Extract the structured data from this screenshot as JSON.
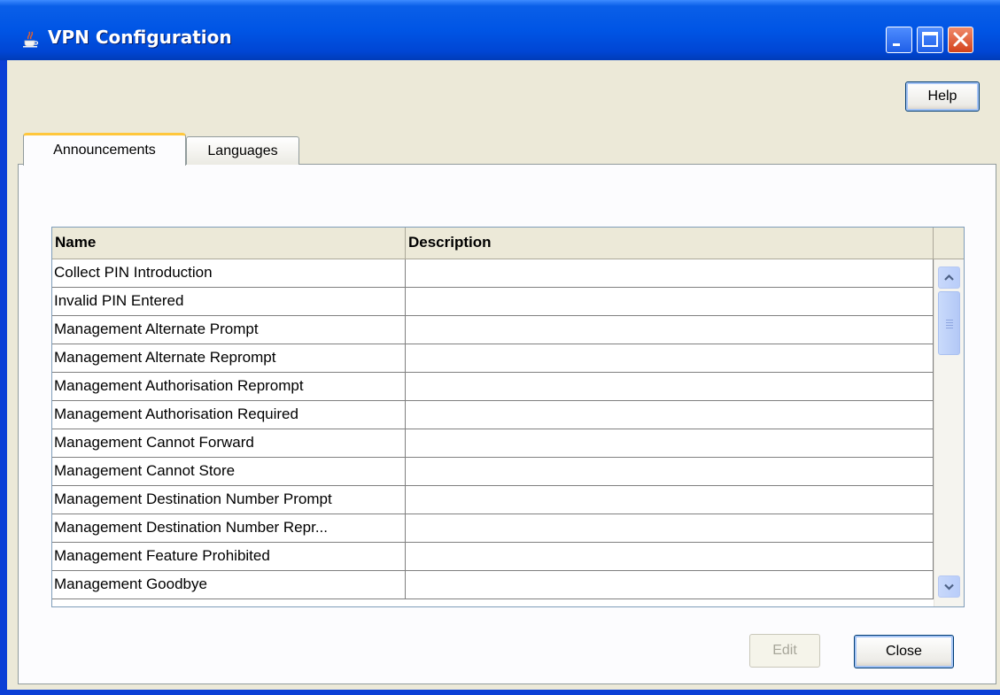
{
  "window": {
    "title": "VPN Configuration"
  },
  "toolbar": {
    "help_label": "Help"
  },
  "tabs": [
    {
      "label": "Announcements",
      "active": true
    },
    {
      "label": "Languages",
      "active": false
    }
  ],
  "table": {
    "columns": [
      "Name",
      "Description"
    ],
    "rows": [
      {
        "name": "Collect PIN Introduction",
        "description": ""
      },
      {
        "name": "Invalid PIN Entered",
        "description": ""
      },
      {
        "name": "Management Alternate Prompt",
        "description": ""
      },
      {
        "name": "Management Alternate Reprompt",
        "description": ""
      },
      {
        "name": "Management Authorisation Reprompt",
        "description": ""
      },
      {
        "name": "Management Authorisation Required",
        "description": ""
      },
      {
        "name": "Management Cannot Forward",
        "description": ""
      },
      {
        "name": "Management Cannot Store",
        "description": ""
      },
      {
        "name": "Management Destination Number Prompt",
        "description": ""
      },
      {
        "name": "Management Destination Number Repr...",
        "description": ""
      },
      {
        "name": "Management Feature Prohibited",
        "description": ""
      },
      {
        "name": "Management Goodbye",
        "description": ""
      }
    ]
  },
  "buttons": {
    "edit_label": "Edit",
    "edit_enabled": false,
    "close_label": "Close"
  },
  "colors": {
    "titlebar": "#0055e5",
    "window_face": "#ece9d8",
    "active_tab_accent": "#ffc73c",
    "close_button": "#d3431c"
  }
}
